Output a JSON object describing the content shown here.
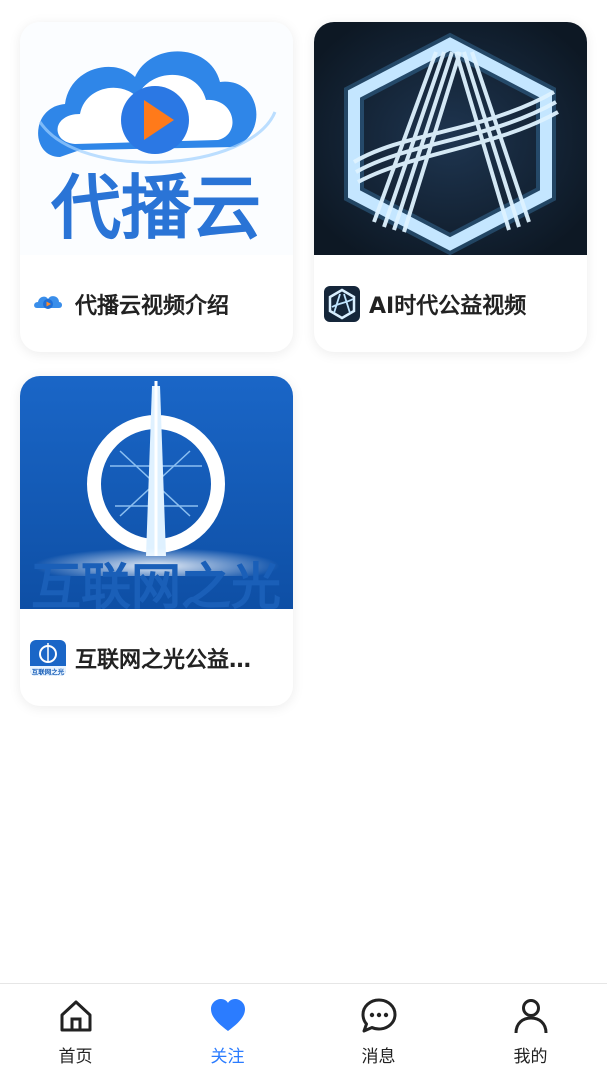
{
  "cards": [
    {
      "title": "代播云视频介绍",
      "thumb_text": "代播云",
      "icon": "cloud-play-icon"
    },
    {
      "title": "AI时代公益视频",
      "thumb_text": "",
      "icon": "ai-hexagon-icon"
    },
    {
      "title": "互联网之光公益…",
      "thumb_text": "互联网之光",
      "icon_text": "互联网之光",
      "icon": "internet-light-logo-icon"
    }
  ],
  "tabbar": {
    "items": [
      {
        "label": "首页",
        "icon": "home-icon"
      },
      {
        "label": "关注",
        "icon": "heart-icon",
        "active": true
      },
      {
        "label": "消息",
        "icon": "message-icon"
      },
      {
        "label": "我的",
        "icon": "user-icon"
      }
    ]
  },
  "colors": {
    "accent": "#2b7cff",
    "text": "#222222"
  }
}
